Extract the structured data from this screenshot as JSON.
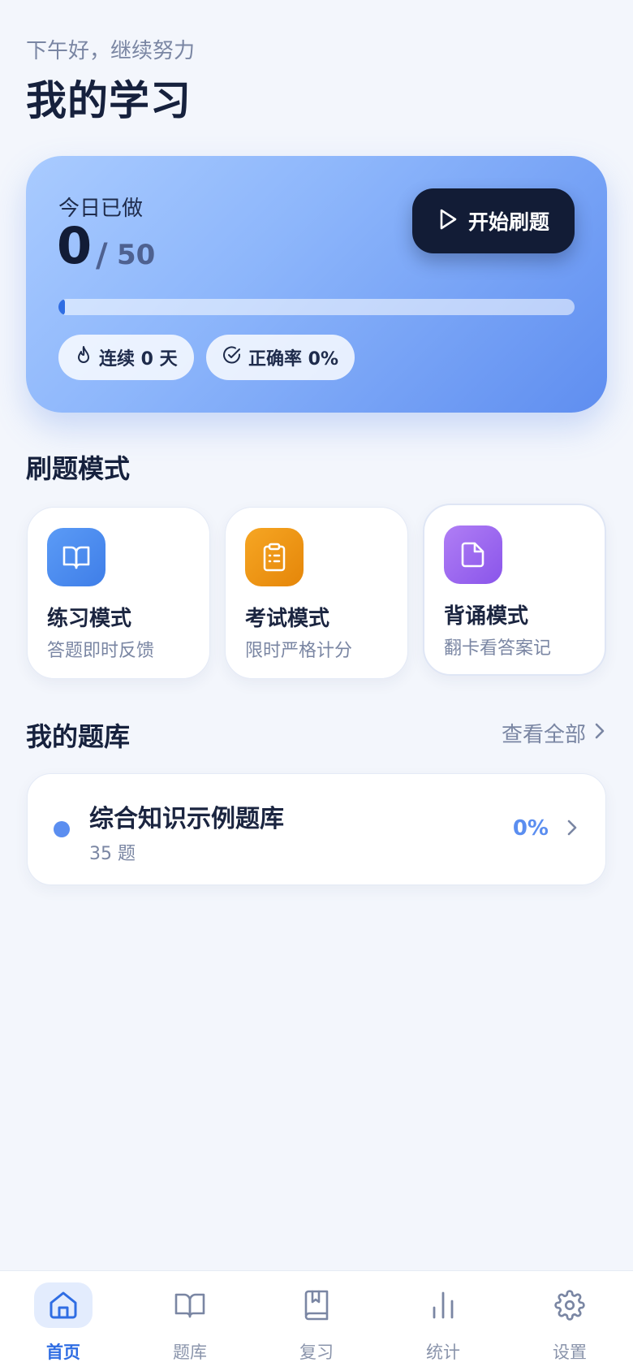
{
  "header": {
    "greeting": "下午好，继续努力",
    "title": "我的学习"
  },
  "today": {
    "label": "今日已做",
    "done": "0",
    "separator": "/",
    "goal": "50",
    "progress_fraction": 0.0,
    "start_button_label": "开始刷题",
    "streak_label": "连续 0 天",
    "accuracy_label": "正确率 0%"
  },
  "modes": {
    "title": "刷题模式",
    "items": [
      {
        "name": "练习模式",
        "desc": "答题即时反馈",
        "icon": "book-open-icon",
        "color": "#4a8cf1"
      },
      {
        "name": "考试模式",
        "desc": "限时严格计分",
        "icon": "clipboard-list-icon",
        "color": "#ef9813"
      },
      {
        "name": "背诵模式",
        "desc": "翻卡看答案记",
        "icon": "note-card-icon",
        "color": "#9a68ef"
      }
    ]
  },
  "question_bank": {
    "title": "我的题库",
    "view_all": "查看全部",
    "items": [
      {
        "name": "综合知识示例题库",
        "count": "35 题",
        "progress": "0%"
      }
    ]
  },
  "nav": {
    "active": "home",
    "items": [
      {
        "id": "home",
        "label": "首页",
        "icon": "home-icon"
      },
      {
        "id": "bank",
        "label": "题库",
        "icon": "book-open-icon"
      },
      {
        "id": "review",
        "label": "复习",
        "icon": "bookmark-book-icon"
      },
      {
        "id": "stats",
        "label": "统计",
        "icon": "bar-chart-icon"
      },
      {
        "id": "settings",
        "label": "设置",
        "icon": "gear-icon"
      }
    ]
  },
  "colors": {
    "accent": "#2f6de3",
    "dark": "#121c36",
    "muted": "#7a86a3"
  }
}
